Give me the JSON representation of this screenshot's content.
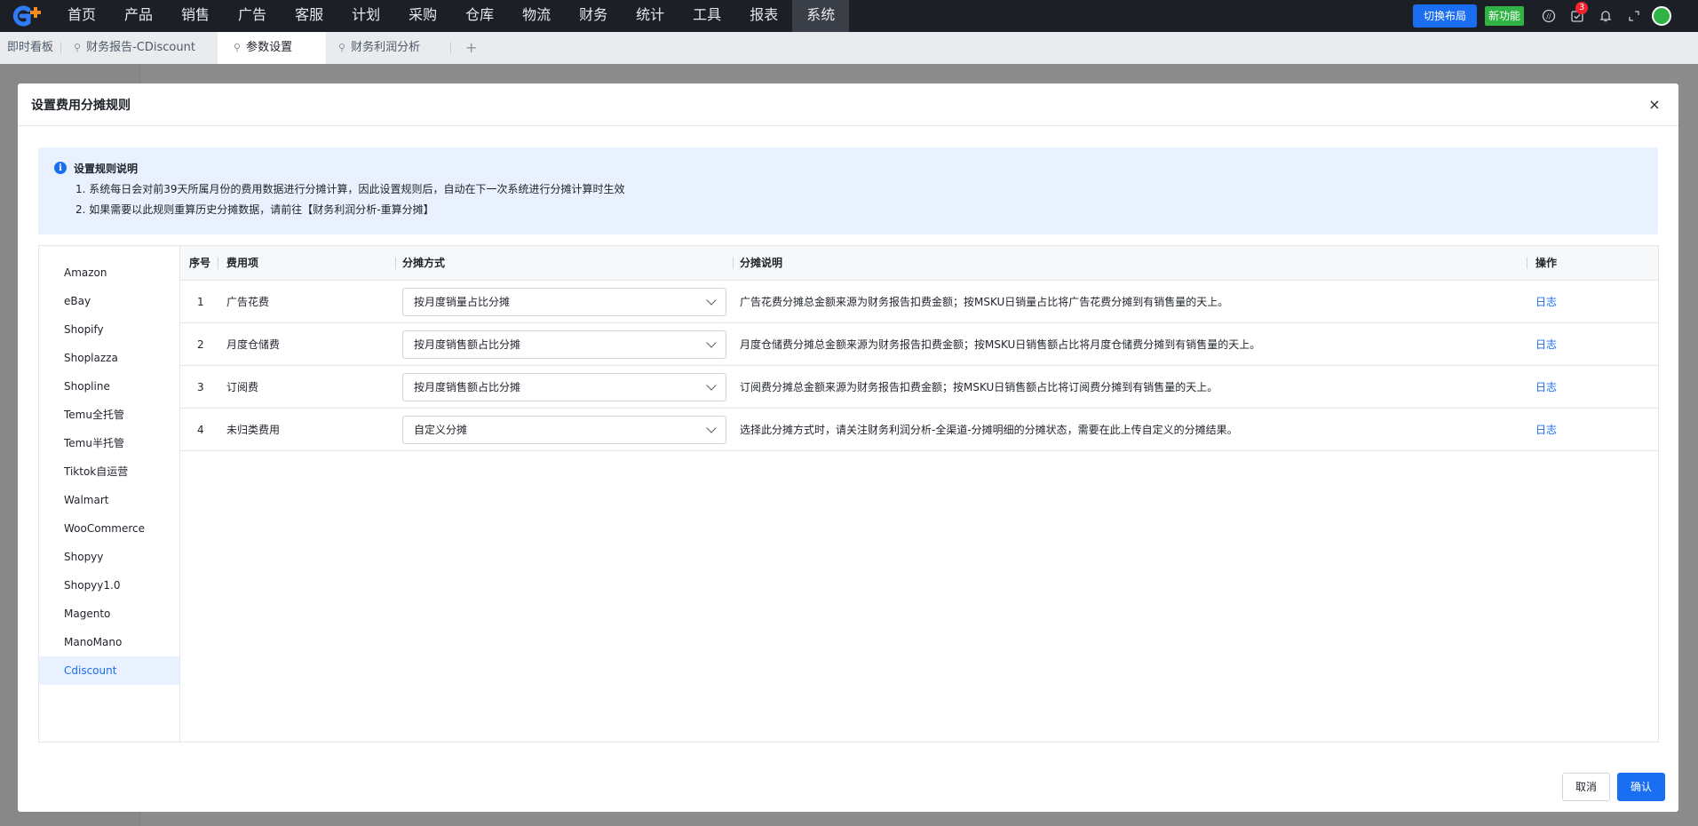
{
  "nav": {
    "items": [
      "首页",
      "产品",
      "销售",
      "广告",
      "客服",
      "计划",
      "采购",
      "仓库",
      "物流",
      "财务",
      "统计",
      "工具",
      "报表",
      "系统"
    ],
    "active": "系统",
    "switch_layout": "切换布局",
    "new_feature": "新功能",
    "notification_count": "3"
  },
  "tabs": {
    "first": "即时看板",
    "items": [
      "财务报告-CDiscount",
      "参数设置",
      "财务利润分析"
    ],
    "active": "参数设置",
    "add": "+"
  },
  "modal": {
    "title": "设置费用分摊规则",
    "close": "×",
    "notice": {
      "title": "设置规则说明",
      "lines": [
        "1. 系统每日会对前39天所属月份的费用数据进行分摊计算，因此设置规则后，自动在下一次系统进行分摊计算时生效",
        "2. 如果需要以此规则重算历史分摊数据，请前往【财务利润分析-重算分摊】"
      ]
    },
    "platforms": [
      "Amazon",
      "eBay",
      "Shopify",
      "Shoplazza",
      "Shopline",
      "Temu全托管",
      "Temu半托管",
      "Tiktok自运营",
      "Walmart",
      "WooCommerce",
      "Shopyy",
      "Shopyy1.0",
      "Magento",
      "ManoMano",
      "Cdiscount"
    ],
    "active_platform": "Cdiscount",
    "table": {
      "headers": {
        "no": "序号",
        "item": "费用项",
        "method": "分摊方式",
        "desc": "分摊说明",
        "op": "操作"
      },
      "rows": [
        {
          "no": "1",
          "item": "广告花费",
          "method": "按月度销量占比分摊",
          "desc": "广告花费分摊总金额来源为财务报告扣费金额；按MSKU日销量占比将广告花费分摊到有销售量的天上。",
          "op": "日志"
        },
        {
          "no": "2",
          "item": "月度仓储费",
          "method": "按月度销售额占比分摊",
          "desc": "月度仓储费分摊总金额来源为财务报告扣费金额；按MSKU日销售额占比将月度仓储费分摊到有销售量的天上。",
          "op": "日志"
        },
        {
          "no": "3",
          "item": "订阅费",
          "method": "按月度销售额占比分摊",
          "desc": "订阅费分摊总金额来源为财务报告扣费金额；按MSKU日销售额占比将订阅费分摊到有销售量的天上。",
          "op": "日志"
        },
        {
          "no": "4",
          "item": "未归类费用",
          "method": "自定义分摊",
          "desc": "选择此分摊方式时，请关注财务利润分析-全渠道-分摊明细的分摊状态，需要在此上传自定义的分摊结果。",
          "op": "日志"
        }
      ]
    },
    "footer": {
      "cancel": "取消",
      "confirm": "确认"
    }
  }
}
